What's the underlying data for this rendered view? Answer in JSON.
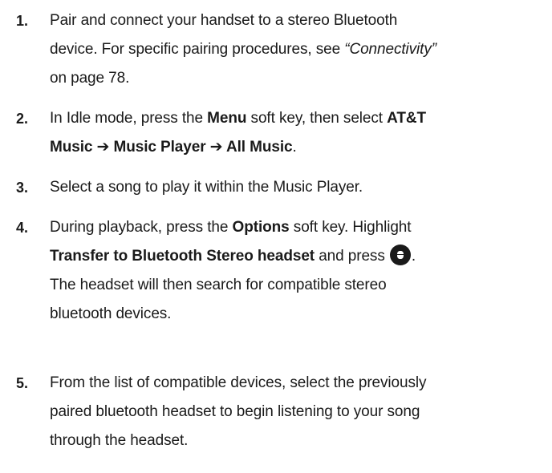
{
  "steps": [
    {
      "number": "1.",
      "lines": [
        [
          "Pair and connect your handset to a stereo Bluetooth"
        ],
        [
          "device. For specific pairing procedures, see ",
          "“Connectivity”"
        ],
        [
          "on page 78."
        ]
      ]
    },
    {
      "number": "2.",
      "lines": [
        [
          "In Idle mode, press the ",
          "Menu",
          " soft key, then select ",
          "AT&T"
        ],
        [
          "Music ➔ Music Player ➔ All Music",
          "."
        ]
      ]
    },
    {
      "number": "3.",
      "lines": [
        [
          "Select a song to play it within the Music Player."
        ]
      ]
    },
    {
      "number": "4.",
      "lines": [
        [
          "During playback, press the ",
          "Options",
          " soft key. Highlight"
        ],
        [
          "Transfer to Bluetooth Stereo headset",
          " and press ",
          "."
        ],
        [
          "The headset will then search for compatible stereo"
        ],
        [
          "bluetooth devices."
        ]
      ],
      "icon": "center-select-key-icon"
    },
    {
      "number": "5.",
      "lines": [
        [
          "From the list of compatible devices, select the previously"
        ],
        [
          "paired bluetooth headset to begin listening to your song"
        ],
        [
          "through the headset."
        ]
      ]
    }
  ]
}
